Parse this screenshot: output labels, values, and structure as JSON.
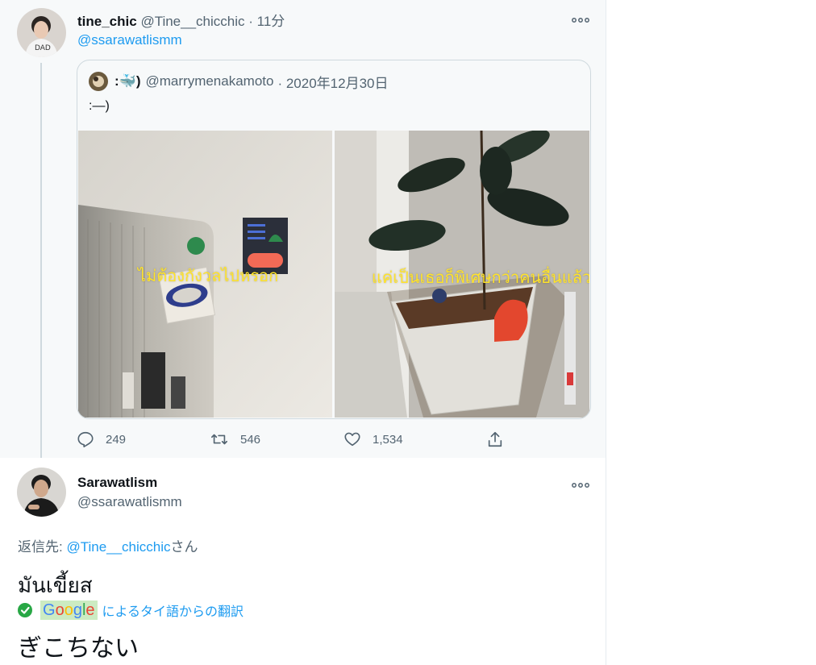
{
  "tweet1": {
    "display_name": "tine_chic",
    "handle": "@Tine__chicchic",
    "time": "· 11分",
    "mention": "@ssarawatlismm",
    "quote": {
      "display_name": ":🐳)",
      "handle": "@marrymenakamoto",
      "date": "· 2020年12月30日",
      "text": ":—)",
      "image_left_caption": "ไม่ต้องกังวลไปหรอก",
      "image_right_caption": "แค่เป็นเธอก็พิเศษกว่าคนอื่นแล้ว"
    },
    "actions": {
      "replies": "249",
      "retweets": "546",
      "likes": "1,534"
    }
  },
  "tweet2": {
    "display_name": "Sarawatlism",
    "handle": "@ssarawatlismm",
    "reply_prefix": "返信先: ",
    "reply_handle": "@Tine__chicchic",
    "reply_suffix": "さん",
    "text": "มันเขี้ยส",
    "translation_label": "によるタイ語からの翻訳",
    "translated_text": "ぎこちない"
  },
  "icons": {
    "more": "more-icon",
    "reply": "reply-icon",
    "retweet": "retweet-icon",
    "like": "heart-icon",
    "share": "share-icon",
    "verified_check": "check-icon"
  },
  "colors": {
    "link": "#1d9bf0",
    "secondary_text": "#536471",
    "caption": "#ffe32a",
    "google_highlight": "#ccebc2"
  }
}
